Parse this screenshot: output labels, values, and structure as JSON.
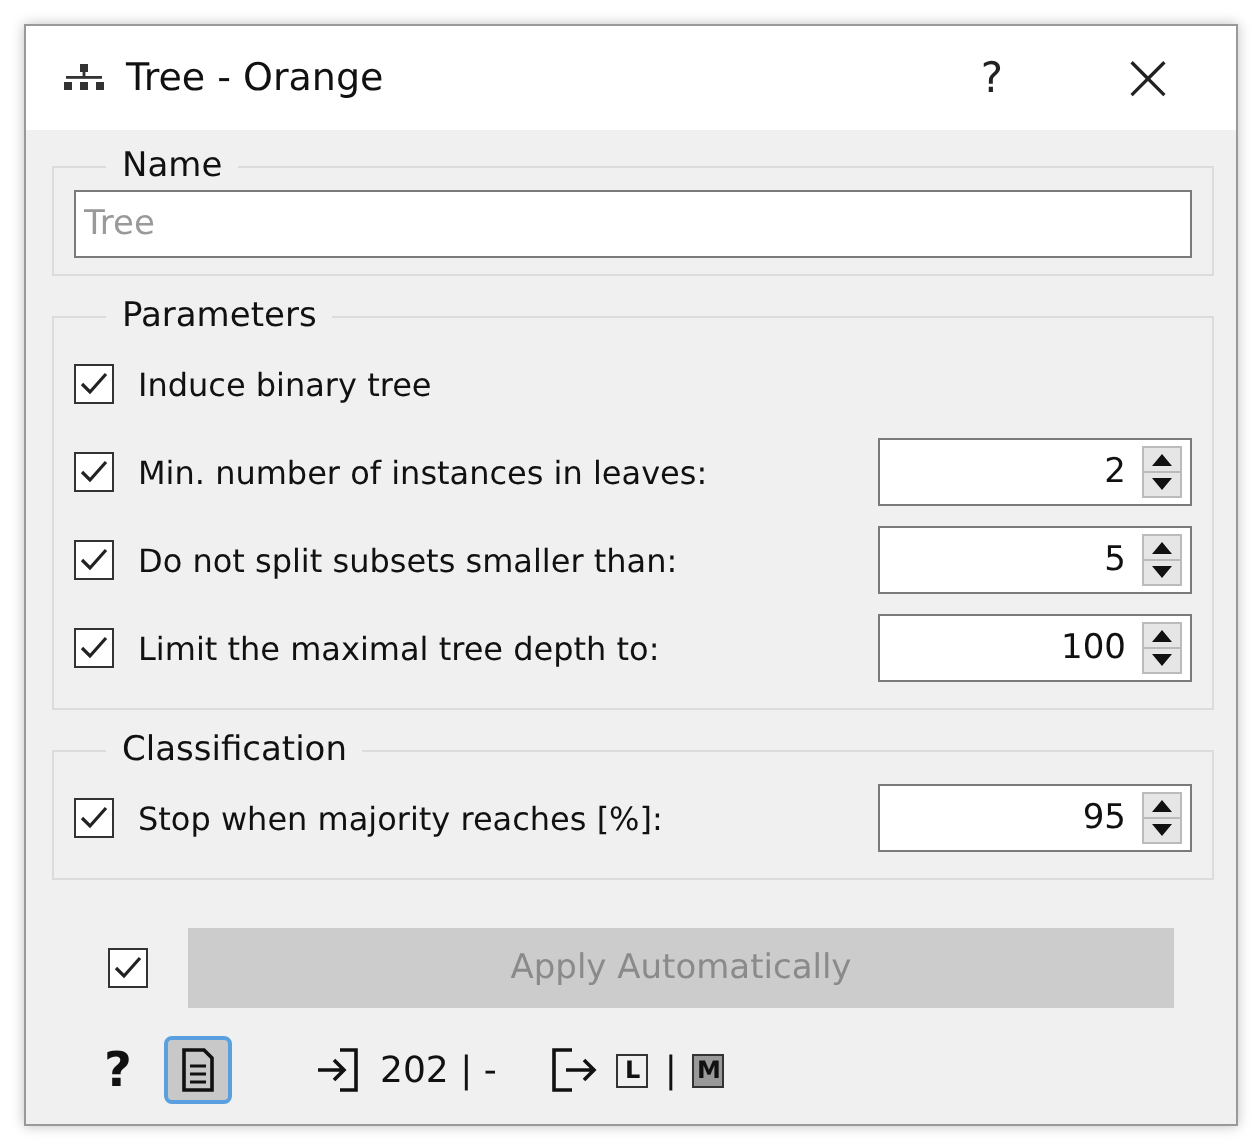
{
  "window": {
    "title": "Tree - Orange",
    "help": "?",
    "close": "×"
  },
  "name_box": {
    "title": "Name",
    "placeholder": "Tree"
  },
  "parameters": {
    "title": "Parameters",
    "items": [
      {
        "kind": "check",
        "label": "Induce binary tree",
        "checked": true
      },
      {
        "kind": "spin",
        "label": "Min. number of instances in leaves:",
        "checked": true,
        "value": "2"
      },
      {
        "kind": "spin",
        "label": "Do not split subsets smaller than:",
        "checked": true,
        "value": "5"
      },
      {
        "kind": "spin",
        "label": "Limit the maximal tree depth to:",
        "checked": true,
        "value": "100"
      }
    ]
  },
  "classification": {
    "title": "Classification",
    "items": [
      {
        "kind": "spin",
        "label": "Stop when majority reaches [%]:",
        "checked": true,
        "value": "95"
      }
    ]
  },
  "apply": {
    "checked": true,
    "label": "Apply Automatically",
    "disabled": true
  },
  "footer": {
    "help": "?",
    "input_count": "202 | -",
    "output_l": "L",
    "separator": "|",
    "output_m": "M"
  }
}
